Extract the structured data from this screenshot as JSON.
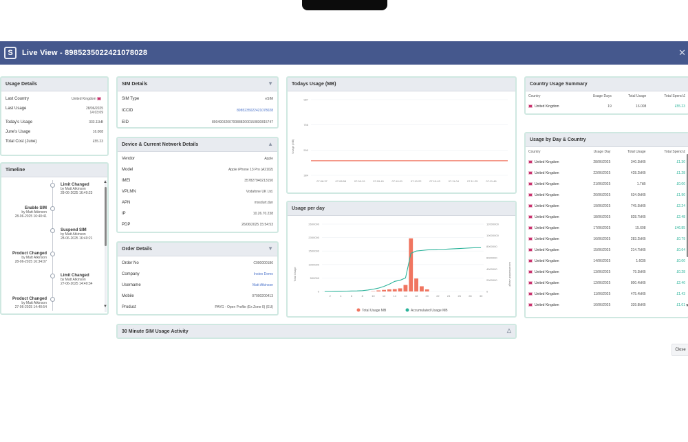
{
  "header": {
    "title": "Live View - 8985235022421078028"
  },
  "usage_details": {
    "title": "Usage Details",
    "rows": [
      {
        "label": "Last Country",
        "value": "United Kingdom"
      },
      {
        "label": "Last Usage",
        "value": "28/06/2025 14:03:09"
      },
      {
        "label": "Today's Usage",
        "value": "333.11kB"
      },
      {
        "label": "June's Usage",
        "value": "16.008"
      },
      {
        "label": "Total Cost (June)",
        "value": "£55.23"
      }
    ]
  },
  "timeline": {
    "title": "Timeline",
    "items": [
      {
        "title": "Limit Changed",
        "by": "by Matt Atkinson",
        "date": "28-06-2025 16:40:23",
        "side": "right"
      },
      {
        "title": "Enable SIM",
        "by": "by Matt Atkinson",
        "date": "28-06-2025 16:40:41",
        "side": "left"
      },
      {
        "title": "Suspend SIM",
        "by": "by Matt Atkinson",
        "date": "28-06-2025 16:40:21",
        "side": "right"
      },
      {
        "title": "Product Changed",
        "by": "by Matt Atkinson",
        "date": "28-06-2025 16:34:07",
        "side": "left"
      },
      {
        "title": "Limit Changed",
        "by": "by Matt Atkinson",
        "date": "27-06-2025 14:40:34",
        "side": "right"
      },
      {
        "title": "Product Changed",
        "by": "by Matt Atkinson",
        "date": "27-06-2025 14:40:54",
        "side": "left"
      }
    ]
  },
  "sim_details": {
    "title": "SIM Details",
    "rows": [
      {
        "label": "SIM Type",
        "value": "eSIM"
      },
      {
        "label": "ICCID",
        "value": "8985235022421078028"
      },
      {
        "label": "EID",
        "value": "89049032007008882000150830815747"
      }
    ]
  },
  "device_details": {
    "title": "Device & Current Network Details",
    "rows": [
      {
        "label": "Vendor",
        "value": "Apple"
      },
      {
        "label": "Model",
        "value": "Apple iPhone 13 Pro (A2102)"
      },
      {
        "label": "IMEI",
        "value": "357827940213150"
      },
      {
        "label": "VPLMN",
        "value": "Vodafone UK Ltd."
      },
      {
        "label": "APN",
        "value": "mxsdurt.dyn"
      },
      {
        "label": "IP",
        "value": "10.26.70.238"
      },
      {
        "label": "PDP",
        "value": "26/06/2025 15:54:53"
      }
    ]
  },
  "order_details": {
    "title": "Order Details",
    "rows": [
      {
        "label": "Order No",
        "value": "C000000186"
      },
      {
        "label": "Company",
        "value": "Instex Demo"
      },
      {
        "label": "Username",
        "value": "Matt Atkinson"
      },
      {
        "label": "Mobile",
        "value": "07000200413"
      },
      {
        "label": "Product",
        "value": "PAYG - Open Profile (Ex Zone 0) (EU)"
      }
    ]
  },
  "activity": {
    "title": "30 Minute SIM Usage Activity"
  },
  "todays_usage": {
    "title": "Todays Usage (MB)",
    "ylabel": "Usage (MB)",
    "yticks": [
      "987",
      "756",
      "500",
      "384"
    ],
    "xticks": [
      "07:08:37",
      "07:08:58",
      "07:09:19",
      "07:09:40",
      "07:10:01",
      "07:10:22",
      "07:10:43",
      "07:11:04",
      "07:11:25",
      "07:11:46"
    ]
  },
  "usage_per_day": {
    "title": "Usage per day",
    "yleft_label": "Total Usage",
    "yright_label": "Accumulated Usage",
    "yleft_ticks": [
      "2600000",
      "2000000",
      "1500000",
      "1000000",
      "500000",
      "0"
    ],
    "yright_ticks": [
      "12000000",
      "10000000",
      "8000000",
      "6000000",
      "4000000",
      "2000000",
      "0"
    ],
    "xticks": [
      "2",
      "4",
      "6",
      "8",
      "10",
      "12",
      "14",
      "16",
      "18",
      "20",
      "22",
      "24",
      "26",
      "28",
      "30"
    ],
    "legend": [
      "Total Usage MB",
      "Accumulated Usage MB"
    ]
  },
  "chart_data": [
    {
      "type": "line",
      "title": "Todays Usage (MB)",
      "ylabel": "Usage (MB)",
      "x": [
        "07:08:37",
        "07:08:58",
        "07:09:19",
        "07:09:40",
        "07:10:01",
        "07:10:22",
        "07:10:43",
        "07:11:04",
        "07:11:25",
        "07:11:46"
      ],
      "series": [
        {
          "values": [
            500,
            500,
            500,
            500,
            500,
            500,
            500,
            500,
            500,
            500
          ]
        }
      ],
      "ylim": [
        384,
        987
      ]
    },
    {
      "type": "bar",
      "title": "Usage per day",
      "x": [
        1,
        2,
        3,
        4,
        5,
        6,
        7,
        8,
        9,
        10,
        11,
        12,
        13,
        14,
        15,
        16,
        17,
        18,
        19,
        20,
        21,
        22,
        23,
        24,
        25,
        26,
        27,
        28,
        29,
        30
      ],
      "series": [
        {
          "name": "Total Usage MB",
          "values": [
            0,
            0,
            0,
            0,
            0,
            0,
            0,
            0,
            0,
            10000,
            40000,
            60000,
            80000,
            90000,
            120000,
            250000,
            2050000,
            500000,
            200000,
            80000,
            0,
            0,
            0,
            0,
            0,
            0,
            0,
            0,
            0,
            0
          ]
        },
        {
          "name": "Accumulated Usage MB",
          "values": [
            0,
            0,
            20000,
            40000,
            60000,
            80000,
            100000,
            150000,
            250000,
            400000,
            600000,
            900000,
            1300000,
            1800000,
            2000000,
            2400000,
            6800000,
            7200000,
            7300000,
            7400000,
            7450000,
            7500000,
            7500000,
            7550000,
            7600000,
            7650000,
            7700000,
            7750000,
            7800000,
            7800000
          ]
        }
      ],
      "ylim_left": [
        0,
        2600000
      ],
      "ylim_right": [
        0,
        12000000
      ]
    }
  ],
  "country_summary": {
    "title": "Country Usage Summary",
    "headers": [
      "Country",
      "Usage Days",
      "Total Usage",
      "Total Spend £"
    ],
    "rows": [
      [
        "United Kingdom",
        "19",
        "16.008",
        "£55.23"
      ]
    ]
  },
  "usage_by_day": {
    "title": "Usage by Day & Country",
    "headers": [
      "Country",
      "Usage Day",
      "Total Usage",
      "Total Spend £"
    ],
    "rows": [
      [
        "United Kingdom",
        "28/06/2025",
        "340.3kKB",
        "£1.30"
      ],
      [
        "United Kingdom",
        "22/06/2025",
        "428.2kKB",
        "£1.28"
      ],
      [
        "United Kingdom",
        "21/06/2025",
        "1.7kB",
        "£0.00"
      ],
      [
        "United Kingdom",
        "20/06/2025",
        "634.0kKB",
        "£1.90"
      ],
      [
        "United Kingdom",
        "19/06/2025",
        "745.5kKB",
        "£2.24"
      ],
      [
        "United Kingdom",
        "18/06/2025",
        "828.7kKB",
        "£2.48"
      ],
      [
        "United Kingdom",
        "17/06/2025",
        "15.608",
        "£46.85"
      ],
      [
        "United Kingdom",
        "16/06/2025",
        "283.2kKB",
        "£0.79"
      ],
      [
        "United Kingdom",
        "15/06/2025",
        "214.7kKB",
        "£0.64"
      ],
      [
        "United Kingdom",
        "14/06/2025",
        "1.6GB",
        "£0.00"
      ],
      [
        "United Kingdom",
        "13/06/2025",
        "79.3kKB",
        "£0.28"
      ],
      [
        "United Kingdom",
        "12/06/2025",
        "800.4kKB",
        "£2.40"
      ],
      [
        "United Kingdom",
        "11/06/2025",
        "475.4kKB",
        "£1.43"
      ],
      [
        "United Kingdom",
        "10/06/2025",
        "339.8kKB",
        "£1.01"
      ]
    ]
  },
  "footer": {
    "close_label": "Close"
  }
}
